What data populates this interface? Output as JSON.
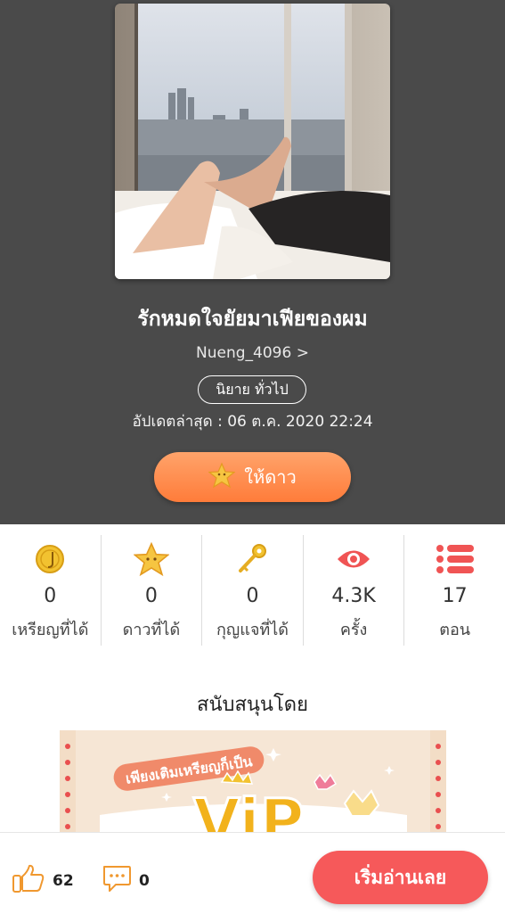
{
  "novel": {
    "title": "รักหมดใจยัยมาเฟียของผม",
    "author": "Nueng_4096 >",
    "category": "นิยาย ทั่วไป",
    "updated": "อัปเดตล่าสุด : 06 ต.ค. 2020 22:24",
    "star_button_label": "ให้ดาว"
  },
  "stats": [
    {
      "icon": "coin-icon",
      "value": "0",
      "label": "เหรียญที่ได้"
    },
    {
      "icon": "star-icon",
      "value": "0",
      "label": "ดาวที่ได้"
    },
    {
      "icon": "key-icon",
      "value": "0",
      "label": "กุญแจที่ได้"
    },
    {
      "icon": "eye-icon",
      "value": "4.3K",
      "label": "ครั้ง"
    },
    {
      "icon": "list-icon",
      "value": "17",
      "label": "ตอน"
    }
  ],
  "sponsor": {
    "heading": "สนับสนุนโดย",
    "banner_text": "เพียงเติมเหรียญก็เป็น",
    "banner_vip": "ViP"
  },
  "bottom_bar": {
    "likes": "62",
    "comments": "0",
    "read_button": "เริ่มอ่านเลย"
  },
  "colors": {
    "header_bg": "#4a4a4a",
    "star_button": "#ff8c4a",
    "read_button": "#f6595a",
    "icon_red": "#f05454",
    "icon_gold": "#f2c230"
  }
}
